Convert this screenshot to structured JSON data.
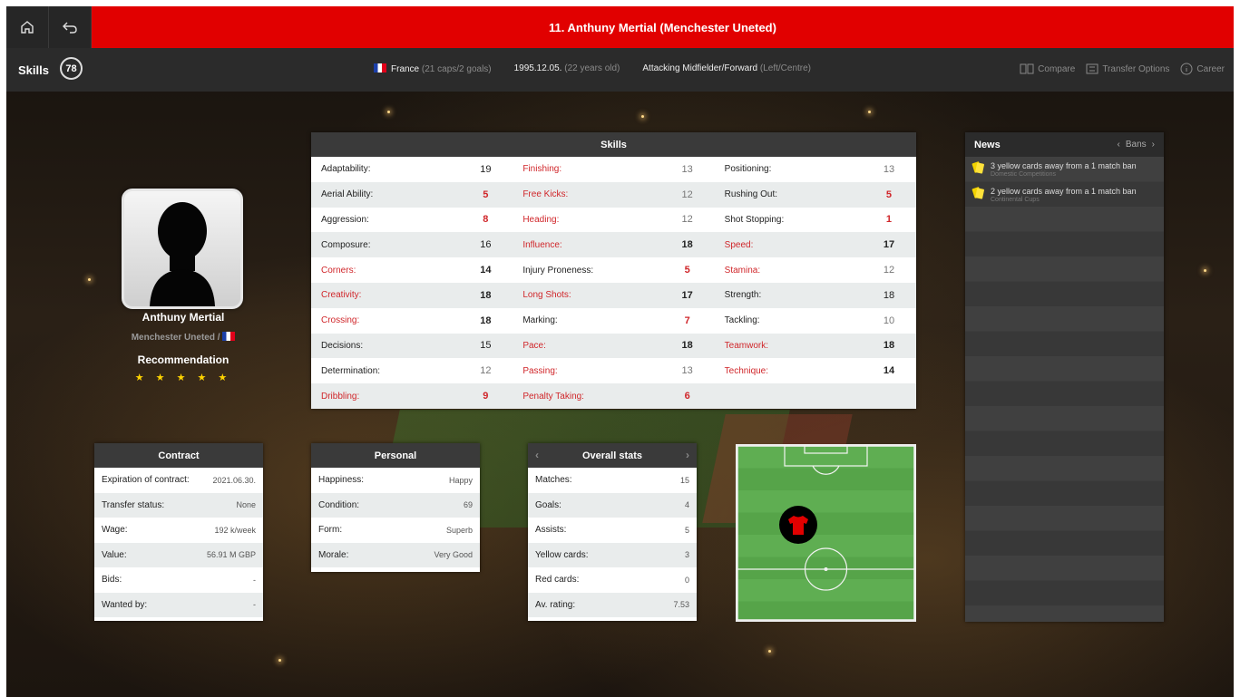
{
  "header": {
    "title": "11. Anthuny Mertial (Menchester Uneted)"
  },
  "subbar": {
    "title": "Skills",
    "rating": "78",
    "nation": "France",
    "caps": "(21 caps/2 goals)",
    "birth": "1995.12.05.",
    "age": "(22 years old)",
    "position": "Attacking Midfielder/Forward",
    "side": "(Left/Centre)",
    "actions": [
      "Compare",
      "Transfer Options",
      "Career"
    ]
  },
  "player": {
    "name": "Anthuny Mertial",
    "club": "Menchester Uneted /",
    "recommendation_label": "Recommendation",
    "stars": "★ ★ ★ ★ ★"
  },
  "skills": {
    "title": "Skills",
    "columns": [
      [
        {
          "label": "Adaptability:",
          "value": "19",
          "color": "normal"
        },
        {
          "label": "Aerial Ability:",
          "value": "5",
          "color": "red"
        },
        {
          "label": "Aggression:",
          "value": "8",
          "color": "red"
        },
        {
          "label": "Composure:",
          "value": "16",
          "color": "normal"
        },
        {
          "label": "Corners:",
          "value": "14",
          "color": "labelred"
        },
        {
          "label": "Creativity:",
          "value": "18",
          "color": "labelred"
        },
        {
          "label": "Crossing:",
          "value": "18",
          "color": "labelred"
        },
        {
          "label": "Decisions:",
          "value": "15",
          "color": "normal"
        },
        {
          "label": "Determination:",
          "value": "12",
          "color": "grey"
        },
        {
          "label": "Dribbling:",
          "value": "9",
          "color": "allred"
        }
      ],
      [
        {
          "label": "Finishing:",
          "value": "13",
          "color": "labelredgrey"
        },
        {
          "label": "Free Kicks:",
          "value": "12",
          "color": "labelredgrey"
        },
        {
          "label": "Heading:",
          "value": "12",
          "color": "labelredgrey"
        },
        {
          "label": "Influence:",
          "value": "18",
          "color": "labelred"
        },
        {
          "label": "Injury Proneness:",
          "value": "5",
          "color": "red"
        },
        {
          "label": "Long Shots:",
          "value": "17",
          "color": "labelred"
        },
        {
          "label": "Marking:",
          "value": "7",
          "color": "red"
        },
        {
          "label": "Pace:",
          "value": "18",
          "color": "labelred"
        },
        {
          "label": "Passing:",
          "value": "13",
          "color": "labelredgrey"
        },
        {
          "label": "Penalty Taking:",
          "value": "6",
          "color": "allred"
        }
      ],
      [
        {
          "label": "Positioning:",
          "value": "13",
          "color": "grey"
        },
        {
          "label": "Rushing Out:",
          "value": "5",
          "color": "red"
        },
        {
          "label": "Shot Stopping:",
          "value": "1",
          "color": "red"
        },
        {
          "label": "Speed:",
          "value": "17",
          "color": "labelred"
        },
        {
          "label": "Stamina:",
          "value": "12",
          "color": "labelredgrey"
        },
        {
          "label": "Strength:",
          "value": "18",
          "color": "normal"
        },
        {
          "label": "Tackling:",
          "value": "10",
          "color": "grey"
        },
        {
          "label": "Teamwork:",
          "value": "18",
          "color": "labelred"
        },
        {
          "label": "Technique:",
          "value": "14",
          "color": "labelred"
        },
        {
          "label": "",
          "value": "",
          "color": "normal"
        }
      ]
    ]
  },
  "contract": {
    "title": "Contract",
    "rows": [
      {
        "label": "Expiration of contract:",
        "value": "2021.06.30."
      },
      {
        "label": "Transfer status:",
        "value": "None"
      },
      {
        "label": "Wage:",
        "value": "192 k/week"
      },
      {
        "label": "Value:",
        "value": "56.91 M GBP"
      },
      {
        "label": "Bids:",
        "value": "-"
      },
      {
        "label": "Wanted by:",
        "value": "-"
      }
    ]
  },
  "personal": {
    "title": "Personal",
    "rows": [
      {
        "label": "Happiness:",
        "value": "Happy"
      },
      {
        "label": "Condition:",
        "value": "69"
      },
      {
        "label": "Form:",
        "value": "Superb"
      },
      {
        "label": "Morale:",
        "value": "Very Good"
      }
    ]
  },
  "overall": {
    "title": "Overall stats",
    "rows": [
      {
        "label": "Matches:",
        "value": "15"
      },
      {
        "label": "Goals:",
        "value": "4"
      },
      {
        "label": "Assists:",
        "value": "5"
      },
      {
        "label": "Yellow cards:",
        "value": "3"
      },
      {
        "label": "Red cards:",
        "value": "0"
      },
      {
        "label": "Av. rating:",
        "value": "7.53"
      }
    ]
  },
  "news": {
    "title": "News",
    "filter": "Bans",
    "items": [
      {
        "text": "3 yellow cards away from a 1 match ban",
        "sub": "Domestic Competitions"
      },
      {
        "text": "2 yellow cards away from a 1 match ban",
        "sub": "Continental Cups"
      }
    ]
  },
  "colors": {
    "accent": "#e10000",
    "stat_red": "#d0262a",
    "pitch": "#5fae52"
  }
}
